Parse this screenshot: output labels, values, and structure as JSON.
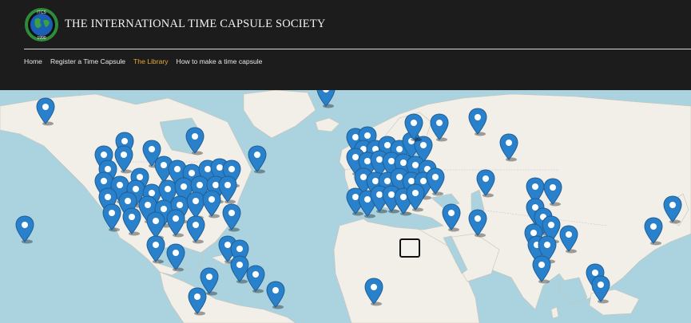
{
  "header": {
    "logo": {
      "icon": "globe-logo-icon",
      "top_text": "ITCS",
      "bottom_text": "1990",
      "colors": {
        "ring": "#2e8b3a",
        "globe": "#1a5fb4"
      }
    },
    "title": "THE INTERNATIONAL TIME CAPSULE SOCIETY"
  },
  "nav": {
    "items": [
      {
        "label": "Home",
        "active": false
      },
      {
        "label": "Register a Time Capsule",
        "active": false
      },
      {
        "label": "The Library",
        "active": true
      },
      {
        "label": "How to make a time capsule",
        "active": false
      }
    ],
    "active_color": "#e8a838"
  },
  "map": {
    "marker_icon": "map-pin-icon",
    "marker_color": "#2a81cb",
    "water_color": "#aad3df",
    "land_color": "#f2efe9"
  }
}
